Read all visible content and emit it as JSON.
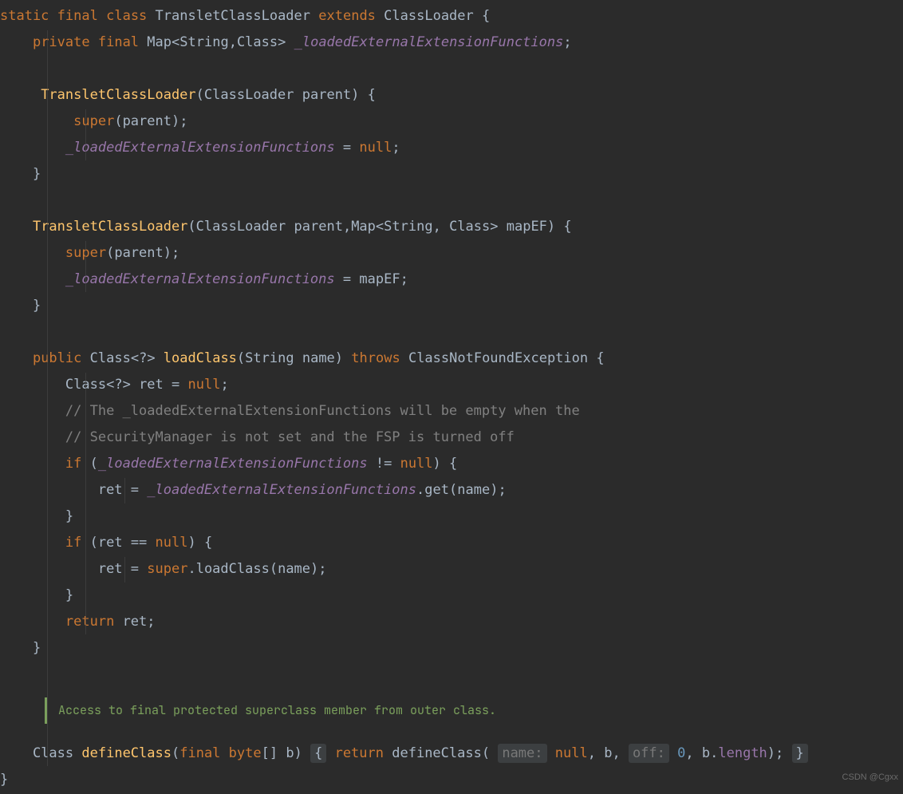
{
  "watermark": "CSDN @Cgxx",
  "annotation": "Access to final protected superclass member from outer class.",
  "tok": {
    "static": "static",
    "final": "final",
    "class": "class",
    "extends": "extends",
    "TransletClassLoader": "TransletClassLoader",
    "ClassLoader": "ClassLoader",
    "private": "private",
    "Map": "Map",
    "String": "String",
    "Class": "Class",
    "loaded": "_loadedExternalExtensionFunctions",
    "parent": "parent",
    "super": "super",
    "null": "null",
    "mapEF": "mapEF",
    "public": "public",
    "loadClass": "loadClass",
    "name": "name",
    "throws": "throws",
    "ClassNotFoundException": "ClassNotFoundException",
    "ret": "ret",
    "cmt1": "// The _loadedExternalExtensionFunctions will be empty when the",
    "cmt2": "// SecurityManager is not set and the FSP is turned off",
    "if": "if",
    "get": "get",
    "return": "return",
    "defineClass": "defineClass",
    "byte": "byte",
    "b": "b",
    "hint_name": "name:",
    "hint_off": "off:",
    "zero": "0",
    "length": "length",
    "q": "?"
  }
}
